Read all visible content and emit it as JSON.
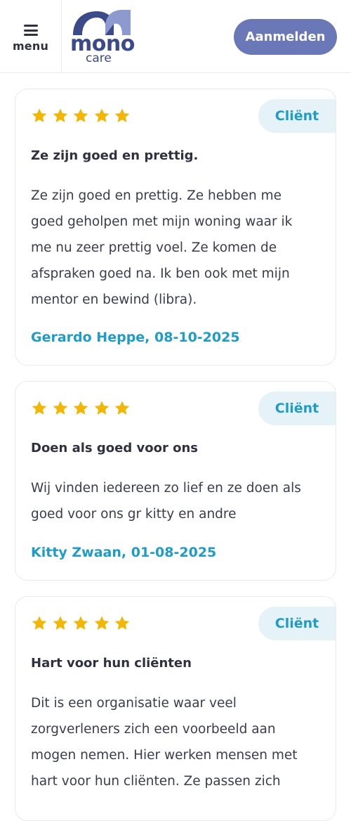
{
  "header": {
    "menu_label": "menu",
    "logo_main": "mono",
    "logo_sub": "care",
    "login_label": "Aanmelden"
  },
  "colors": {
    "brand": "#3b4a88",
    "button": "#6b78b8",
    "accent": "#1f9bc7",
    "badge_bg": "#e5f3f8",
    "star": "#f2b705"
  },
  "reviews": [
    {
      "rating": 5,
      "badge": "Cliënt",
      "title": "Ze zijn goed en prettig.",
      "lines": [
        "Ze zijn goed en prettig. Ze hebben me",
        "goed geholpen met mijn woning waar ik",
        "me nu zeer prettig voel. Ze komen de",
        "afspraken goed na. Ik ben ook met mijn",
        "mentor en bewind (libra)."
      ],
      "author": "Gerardo Heppe, 08-10-2025"
    },
    {
      "rating": 5,
      "badge": "Cliënt",
      "title": "Doen als goed voor ons",
      "lines": [
        "Wij vinden iedereen zo lief en ze doen als",
        "goed voor ons gr kitty en andre"
      ],
      "author": "Kitty Zwaan, 01-08-2025"
    },
    {
      "rating": 5,
      "badge": "Cliënt",
      "title": "Hart voor hun cliënten",
      "lines": [
        "Dit is een organisatie waar veel",
        "zorgverleners zich een voorbeeld aan",
        "mogen nemen. Hier werken mensen met",
        "hart voor hun cliënten. Ze passen zich"
      ],
      "author": ""
    }
  ]
}
